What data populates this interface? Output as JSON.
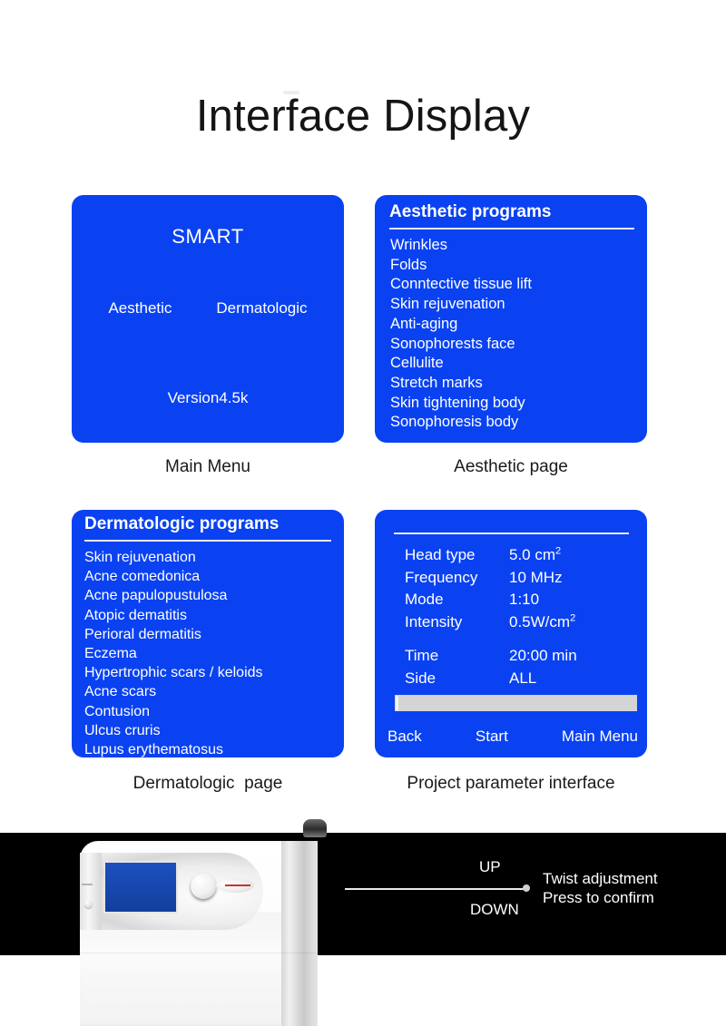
{
  "page": {
    "title": "Interface Display",
    "accent_blue": "#0A42F2",
    "band_color": "#000000",
    "text_color": "#1a1a1a"
  },
  "screens": {
    "main_menu": {
      "caption": "Main Menu",
      "title": "SMART",
      "option_left": "Aesthetic",
      "option_right": "Dermatologic",
      "version": "Version4.5k"
    },
    "aesthetic": {
      "caption": "Aesthetic page",
      "header": "Aesthetic programs",
      "items": [
        "Wrinkles",
        " Folds",
        "Conntective tissue lift",
        "Skin rejuvenation",
        "Anti-aging",
        "Sonophorests face",
        "Cellulite",
        "Stretch marks",
        "Skin tightening body",
        "Sonophoresis body"
      ]
    },
    "dermatologic": {
      "caption": "Dermatologic  page",
      "header": "Dermatologic programs",
      "items": [
        "Skin rejuvenation",
        "Acne comedonica",
        "Acne papulopustulosa",
        "Atopic dematitis",
        "Perioral dermatitis",
        "Eczema",
        "Hypertrophic scars / keloids",
        "Acne scars",
        "Contusion",
        "Ulcus cruris",
        "Lupus erythematosus"
      ]
    },
    "parameters": {
      "caption": "Project parameter interface",
      "rows": [
        {
          "label": "Head type",
          "value": "5.0 cm",
          "sup": "2"
        },
        {
          "label": "Frequency",
          "value": "10  MHz",
          "sup": ""
        },
        {
          "label": "Mode",
          "value": " 1:10",
          "sup": ""
        },
        {
          "label": "Intensity",
          "value": "0.5W/cm",
          "sup": "2"
        }
      ],
      "rows2": [
        {
          "label": "Time",
          "value": "20:00 min",
          "sup": ""
        },
        {
          "label": "Side",
          "value": "ALL",
          "sup": ""
        }
      ],
      "progress_percent": 1,
      "buttons": {
        "back": "Back",
        "start": "Start",
        "main_menu": "Main Menu"
      }
    }
  },
  "callout": {
    "up": "UP",
    "down": "DOWN",
    "line1": "Twist adjustment",
    "line2": "Press to confirm"
  }
}
